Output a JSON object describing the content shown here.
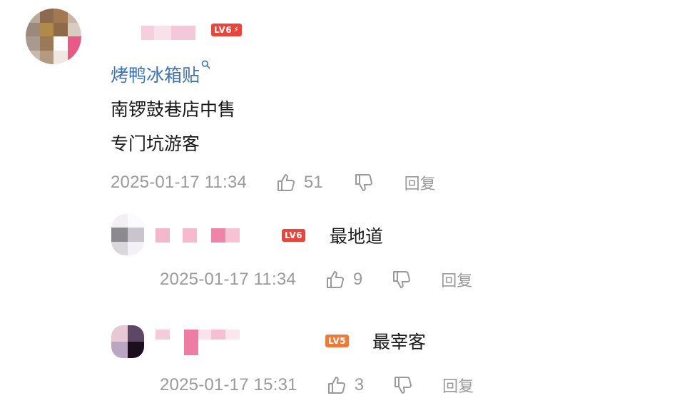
{
  "comment": {
    "author_level": "LV6",
    "author_level_color": "#e8453c",
    "topic_link": "烤鸭冰箱贴",
    "topic_link_color": "#3d73b3",
    "body_lines": [
      "南锣鼓巷店中售",
      "专门坑游客"
    ],
    "timestamp": "2025-01-17 11:34",
    "like_count": "51",
    "reply_label": "回复"
  },
  "replies": [
    {
      "author_level": "LV6",
      "author_level_color": "#e8453c",
      "text": "最地道",
      "timestamp": "2025-01-17 11:34",
      "like_count": "9",
      "reply_label": "回复"
    },
    {
      "author_level": "LV5",
      "author_level_color": "#f07a3a",
      "text": "最宰客",
      "timestamp": "2025-01-17 15:31",
      "like_count": "3",
      "reply_label": "回复"
    }
  ],
  "icons": {
    "like": "thumbs-up-icon",
    "dislike": "thumbs-down-icon",
    "topic_search": "search-icon",
    "badge_bolt": "lightning-icon"
  },
  "colors": {
    "meta_text": "#9a9a9a",
    "body_text": "#1a1a1a"
  }
}
